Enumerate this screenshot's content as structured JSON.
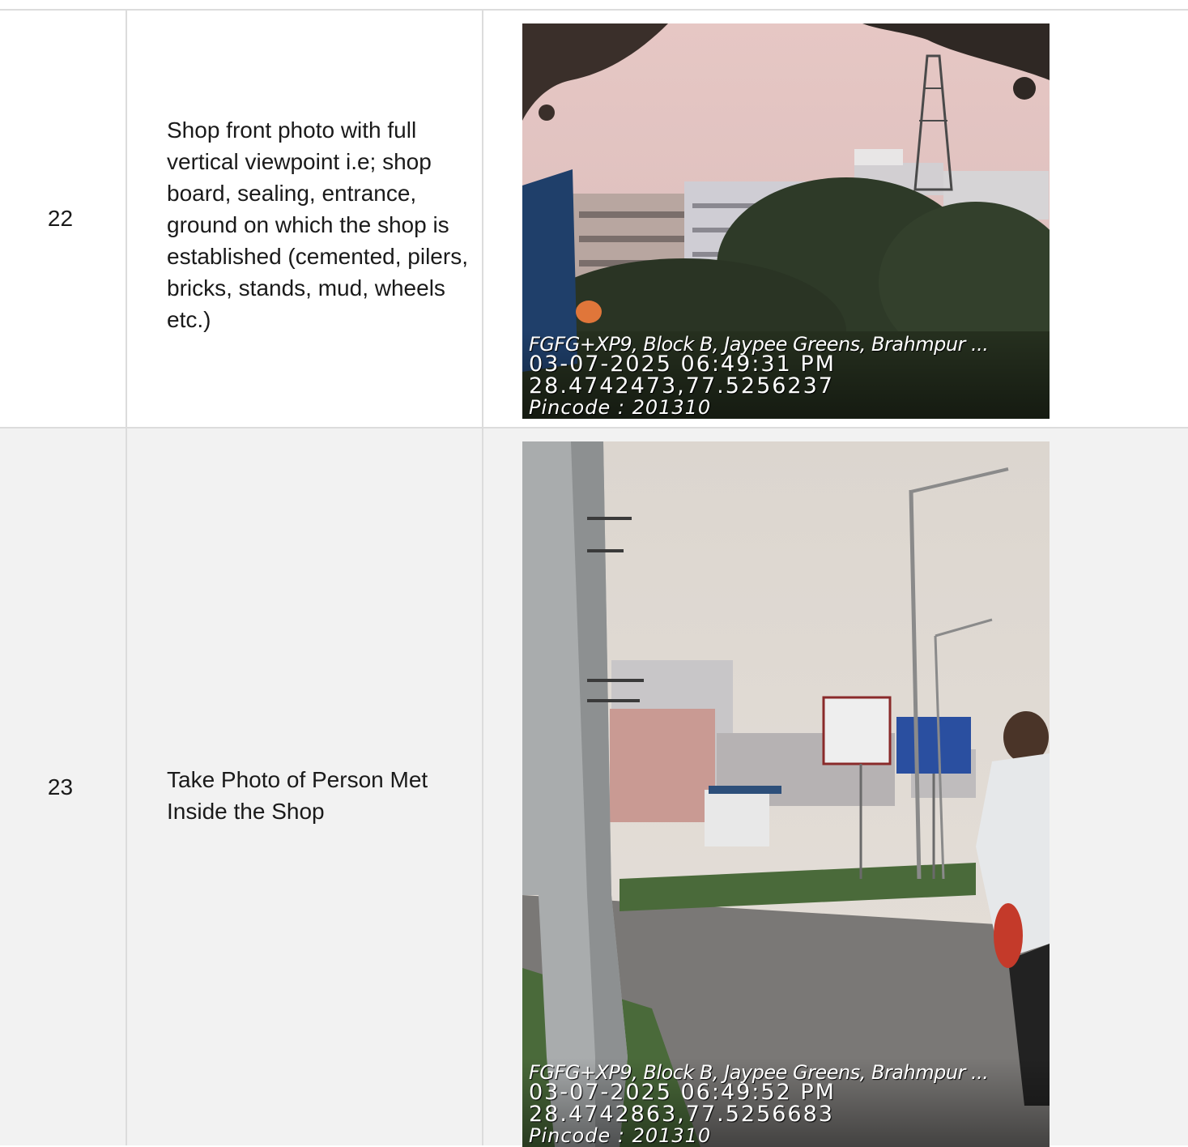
{
  "rows": [
    {
      "number": "22",
      "description": "Shop front photo with full vertical viewpoint i.e; shop board, sealing, entrance, ground on which the shop is established (cemented, pilers, bricks, stands, mud, wheels etc.)",
      "photo": {
        "address": "FGFG+XP9, Block B, Jaypee Greens, Brahmpur ...",
        "datetime": "03-07-2025 06:49:31 PM",
        "coordinates": "28.4742473,77.5256237",
        "pincode": "Pincode : 201310"
      }
    },
    {
      "number": "23",
      "description": "Take Photo of Person Met Inside the Shop",
      "photo": {
        "address": "FGFG+XP9, Block B, Jaypee Greens, Brahmpur ...",
        "datetime": "03-07-2025 06:49:52 PM",
        "coordinates": "28.4742863,77.5256683",
        "pincode": "Pincode : 201310"
      }
    }
  ],
  "colors": {
    "border": "#dcdcdc",
    "row_alt": "#f2f2f2",
    "text": "#1a1a1a"
  }
}
